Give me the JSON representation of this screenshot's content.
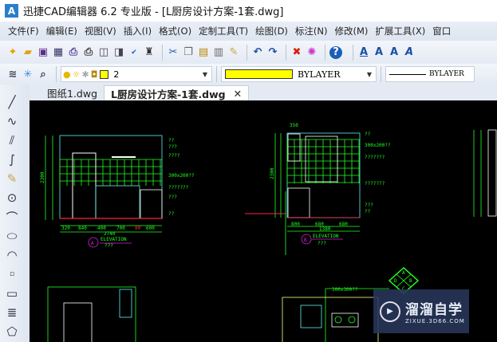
{
  "window": {
    "title": "迅捷CAD编辑器 6.2 专业版  - [L厨房设计方案-1套.dwg]",
    "logo": "A"
  },
  "menu": [
    "文件(F)",
    "编辑(E)",
    "视图(V)",
    "插入(I)",
    "格式(O)",
    "定制工具(T)",
    "绘图(D)",
    "标注(N)",
    "修改(M)",
    "扩展工具(X)",
    "窗口"
  ],
  "toolbar2": {
    "layer_value": "2",
    "color_value": "BYLAYER",
    "linetype_value": "BYLAYER",
    "layer_color": "#ffff00"
  },
  "tabs": [
    {
      "label": "图纸1.dwg"
    },
    {
      "label": "L厨房设计方案-1套.dwg",
      "close": "✕"
    }
  ],
  "drawing": {
    "a": {
      "dims": [
        "320",
        "840",
        "400",
        "700",
        "80",
        "600"
      ],
      "total": "2740",
      "height": "2300",
      "elev_letter": "A",
      "elev_label": "ELEVATION",
      "elev_sub": "???",
      "notes": [
        "??",
        "???",
        "????",
        "300x200??",
        "???????",
        "???",
        "??"
      ]
    },
    "b": {
      "dims": [
        "800",
        "680",
        "680"
      ],
      "total": "1380",
      "top": "350",
      "height": "2300",
      "elev_letter": "B",
      "elev_label": "ELEVATION",
      "elev_sub": "???",
      "notes": [
        "??",
        "300x200??",
        "???????",
        "???????",
        "???",
        "??"
      ]
    },
    "c": {
      "note": "300x300??",
      "compass": [
        "A",
        "B",
        "C",
        "D"
      ]
    }
  },
  "watermark": {
    "title": "溜溜自学",
    "url": "ZIXUE.3D66.COM"
  }
}
